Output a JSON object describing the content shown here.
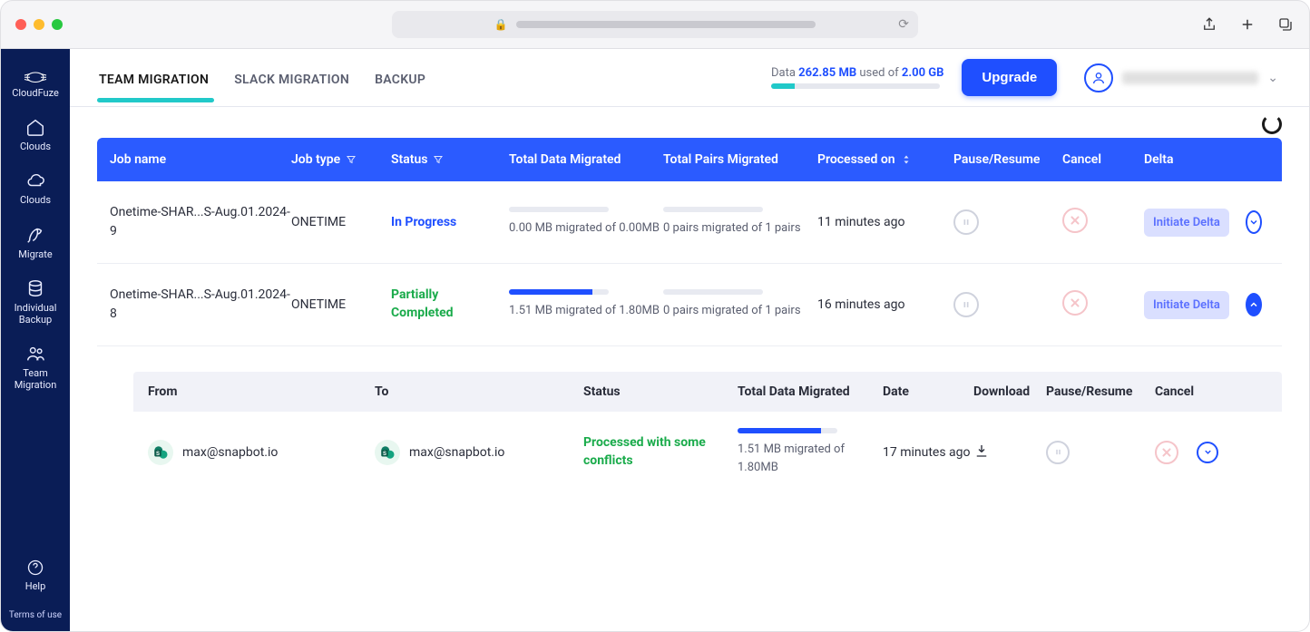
{
  "sidebar": {
    "brand": "CloudFuze",
    "items": [
      {
        "label": "Clouds"
      },
      {
        "label": "Clouds"
      },
      {
        "label": "Migrate"
      },
      {
        "label": "Individual\nBackup"
      },
      {
        "label": "Team\nMigration"
      }
    ],
    "help": "Help",
    "terms": "Terms of use"
  },
  "topbar": {
    "tabs": [
      {
        "label": "TEAM MIGRATION",
        "active": true
      },
      {
        "label": "SLACK MIGRATION",
        "active": false
      },
      {
        "label": "BACKUP",
        "active": false
      }
    ],
    "quota": {
      "prefix": "Data",
      "used": "262.85 MB",
      "mid": "used of",
      "limit": "2.00 GB",
      "percent": 14
    },
    "upgrade": "Upgrade"
  },
  "columns": {
    "job_name": "Job name",
    "job_type": "Job type",
    "status": "Status",
    "total_data": "Total Data Migrated",
    "total_pairs": "Total Pairs Migrated",
    "processed_on": "Processed on",
    "pause_resume": "Pause/Resume",
    "cancel": "Cancel",
    "delta": "Delta"
  },
  "rows": [
    {
      "job_name": "Onetime-SHAR...S-Aug.01.2024-9",
      "job_type": "ONETIME",
      "status": "In Progress",
      "status_kind": "inprog",
      "data_progress_pct": 0,
      "data_text": "0.00 MB migrated of 0.00MB",
      "pairs_progress_pct": 0,
      "pairs_text": "0 pairs migrated of 1 pairs",
      "processed_on": "11 minutes ago",
      "delta_label": "Initiate Delta",
      "expanded": false
    },
    {
      "job_name": "Onetime-SHAR...S-Aug.01.2024-8",
      "job_type": "ONETIME",
      "status": "Partially\nCompleted",
      "status_kind": "partial",
      "data_progress_pct": 84,
      "data_text": "1.51 MB migrated of 1.80MB",
      "pairs_progress_pct": 0,
      "pairs_text": "0 pairs migrated of 1 pairs",
      "processed_on": "16 minutes ago",
      "delta_label": "Initiate Delta",
      "expanded": true
    }
  ],
  "detail": {
    "columns": {
      "from": "From",
      "to": "To",
      "status": "Status",
      "total_data": "Total Data Migrated",
      "date": "Date",
      "download": "Download",
      "pause_resume": "Pause/Resume",
      "cancel": "Cancel"
    },
    "row": {
      "from": "max@snapbot.io",
      "to": "max@snapbot.io",
      "status": "Processed with some conflicts",
      "data_progress_pct": 84,
      "data_text": "1.51 MB migrated of 1.80MB",
      "date": "17 minutes ago"
    }
  }
}
